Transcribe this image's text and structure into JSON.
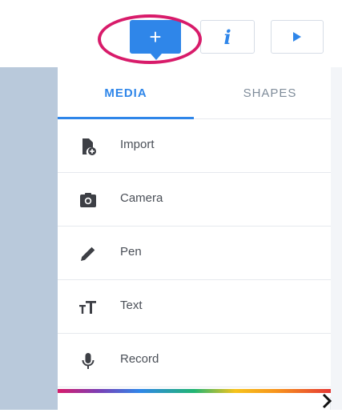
{
  "toolbar": {
    "add_label": "+",
    "info_label": "i",
    "play_label": "▶"
  },
  "tabs": [
    {
      "label": "MEDIA",
      "active": true
    },
    {
      "label": "SHAPES",
      "active": false
    }
  ],
  "menu": {
    "items": [
      {
        "label": "Import",
        "icon": "import-file-icon"
      },
      {
        "label": "Camera",
        "icon": "camera-icon"
      },
      {
        "label": "Pen",
        "icon": "pen-icon"
      },
      {
        "label": "Text",
        "icon": "text-icon"
      },
      {
        "label": "Record",
        "icon": "microphone-icon"
      }
    ]
  },
  "colors": {
    "accent": "#2f86e9",
    "highlight": "#d81b6a",
    "side_panel": "#b9c9db",
    "icon": "#3d3f45"
  }
}
